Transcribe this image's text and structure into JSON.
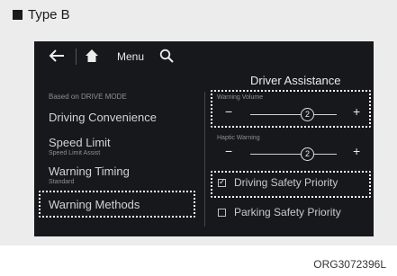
{
  "caption": {
    "label": "Type B"
  },
  "topbar": {
    "menu_label": "Menu"
  },
  "section": {
    "title": "Driver Assistance"
  },
  "left_menu": {
    "caption": "Based on DRIVE MODE",
    "items": [
      {
        "title": "Driving Convenience",
        "subtitle": ""
      },
      {
        "title": "Speed Limit",
        "subtitle": "Speed Limit Assist"
      },
      {
        "title": "Warning Timing",
        "subtitle": "Standard"
      },
      {
        "title": "Warning Methods",
        "subtitle": ""
      }
    ]
  },
  "controls": {
    "warning_volume": {
      "label": "Warning Volume",
      "value": "2",
      "minus": "−",
      "plus": "+"
    },
    "haptic_warning": {
      "label": "Haptic Warning",
      "value": "2",
      "minus": "−",
      "plus": "+"
    },
    "options": [
      {
        "label": "Driving Safety Priority",
        "checked": true,
        "mark": "✓"
      },
      {
        "label": "Parking Safety Priority",
        "checked": false,
        "mark": ""
      }
    ]
  },
  "footer": {
    "code": "ORG3072396L"
  }
}
